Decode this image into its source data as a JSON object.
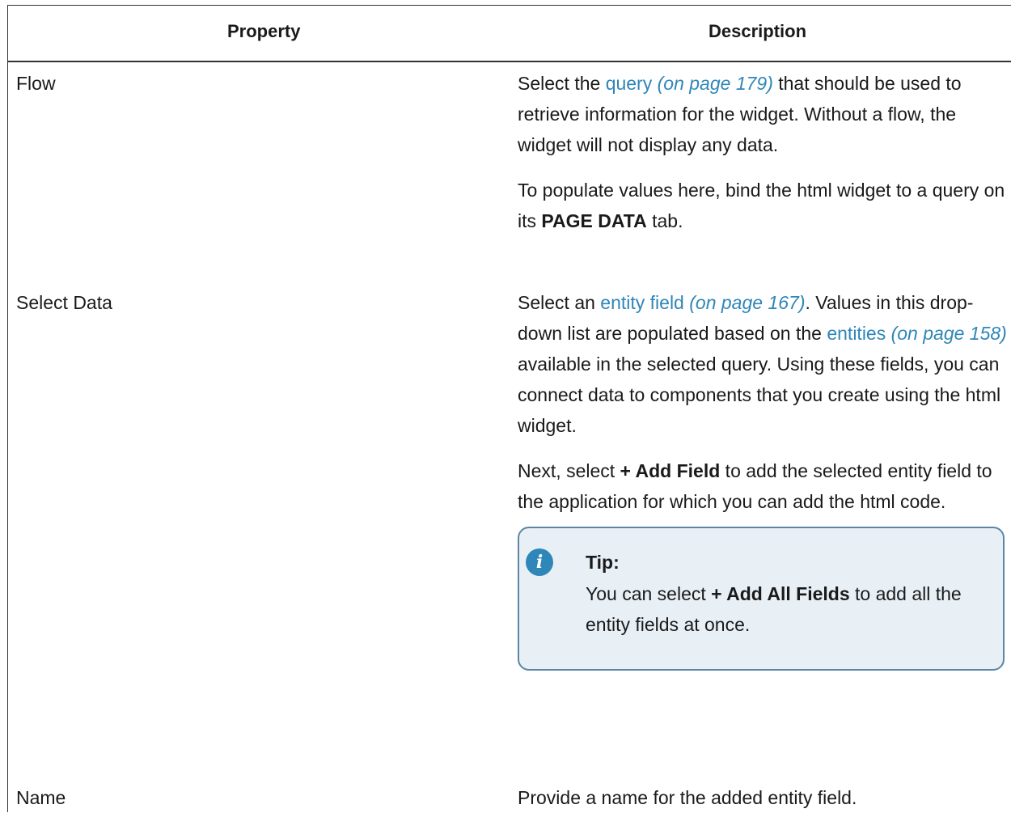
{
  "table": {
    "headers": {
      "property": "Property",
      "description": "Description"
    },
    "rows": {
      "flow": {
        "property": "Flow",
        "p1": {
          "pre": "Select the ",
          "link": "query",
          "ref": "(on page 179)",
          "post": " that should be used to retrieve information for the widget. Without a flow, the widget will not display any data."
        },
        "p2": {
          "pre": "To populate values here, bind the html widget to a query on its ",
          "bold": "PAGE DATA",
          "post": " tab."
        }
      },
      "select_data": {
        "property": "Select Data",
        "p1": {
          "pre": "Select an ",
          "link1": "entity field",
          "ref1": "(on page 167)",
          "mid": ". Values in this drop-down list are populated based on the ",
          "link2": "entities",
          "ref2": "(on page 158)",
          "post": " available in the selected query. Using these fields, you can connect data to components that you create using the html widget."
        },
        "p2": {
          "pre": "Next, select ",
          "bold": "+ Add Field",
          "post": " to add the selected entity field to the application for which you can add the html code."
        },
        "tip": {
          "icon": "info-icon",
          "glyph": "i",
          "title": "Tip:",
          "pre": "You can select ",
          "bold": "+ Add All Fields",
          "post": " to add all the entity fields at once."
        }
      },
      "name": {
        "property": "Name",
        "description": "Provide a name for the added entity field."
      }
    }
  },
  "colors": {
    "link": "#2f86b8",
    "tip_background": "#e8f0f6",
    "tip_border": "#5b86a6"
  }
}
